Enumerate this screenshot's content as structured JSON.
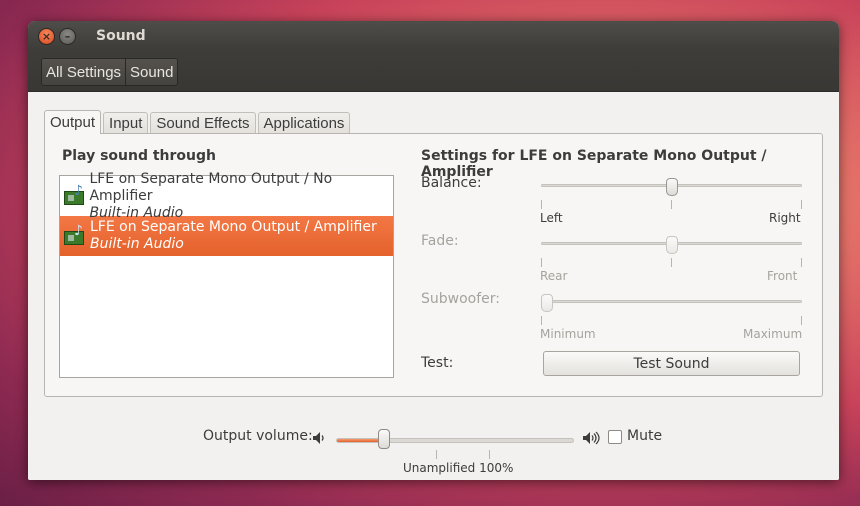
{
  "window": {
    "title": "Sound"
  },
  "toolbar": {
    "crumbs": [
      "All Settings",
      "Sound"
    ]
  },
  "tabs": [
    "Output",
    "Input",
    "Sound Effects",
    "Applications"
  ],
  "active_tab": "Output",
  "output": {
    "list_heading": "Play sound through",
    "devices": [
      {
        "name": "LFE on Separate Mono Output / No Amplifier",
        "sub": "Built-in Audio",
        "selected": false
      },
      {
        "name": "LFE on Separate Mono Output / Amplifier",
        "sub": "Built-in Audio",
        "selected": true
      }
    ],
    "settings_heading": "Settings for LFE on Separate Mono Output / Amplifier",
    "balance": {
      "label": "Balance:",
      "min_label": "Left",
      "max_label": "Right",
      "value": 0.5,
      "enabled": true
    },
    "fade": {
      "label": "Fade:",
      "min_label": "Rear",
      "max_label": "Front",
      "value": 0.5,
      "enabled": false
    },
    "subwoofer": {
      "label": "Subwoofer:",
      "min_label": "Minimum",
      "max_label": "Maximum",
      "value": 0.0,
      "enabled": false
    },
    "test": {
      "label": "Test:",
      "button": "Test Sound"
    }
  },
  "volume": {
    "label": "Output volume:",
    "value_percent": 20,
    "mute_label": "Mute",
    "muted": false,
    "marks": "Unamplified 100%"
  },
  "colors": {
    "accent": "#e95420",
    "selection": "#ee6a33",
    "titlebar": "#3c3b37"
  },
  "icons": [
    "close-icon",
    "minimize-icon",
    "sound-card-icon",
    "speaker-low-icon",
    "speaker-high-icon"
  ]
}
